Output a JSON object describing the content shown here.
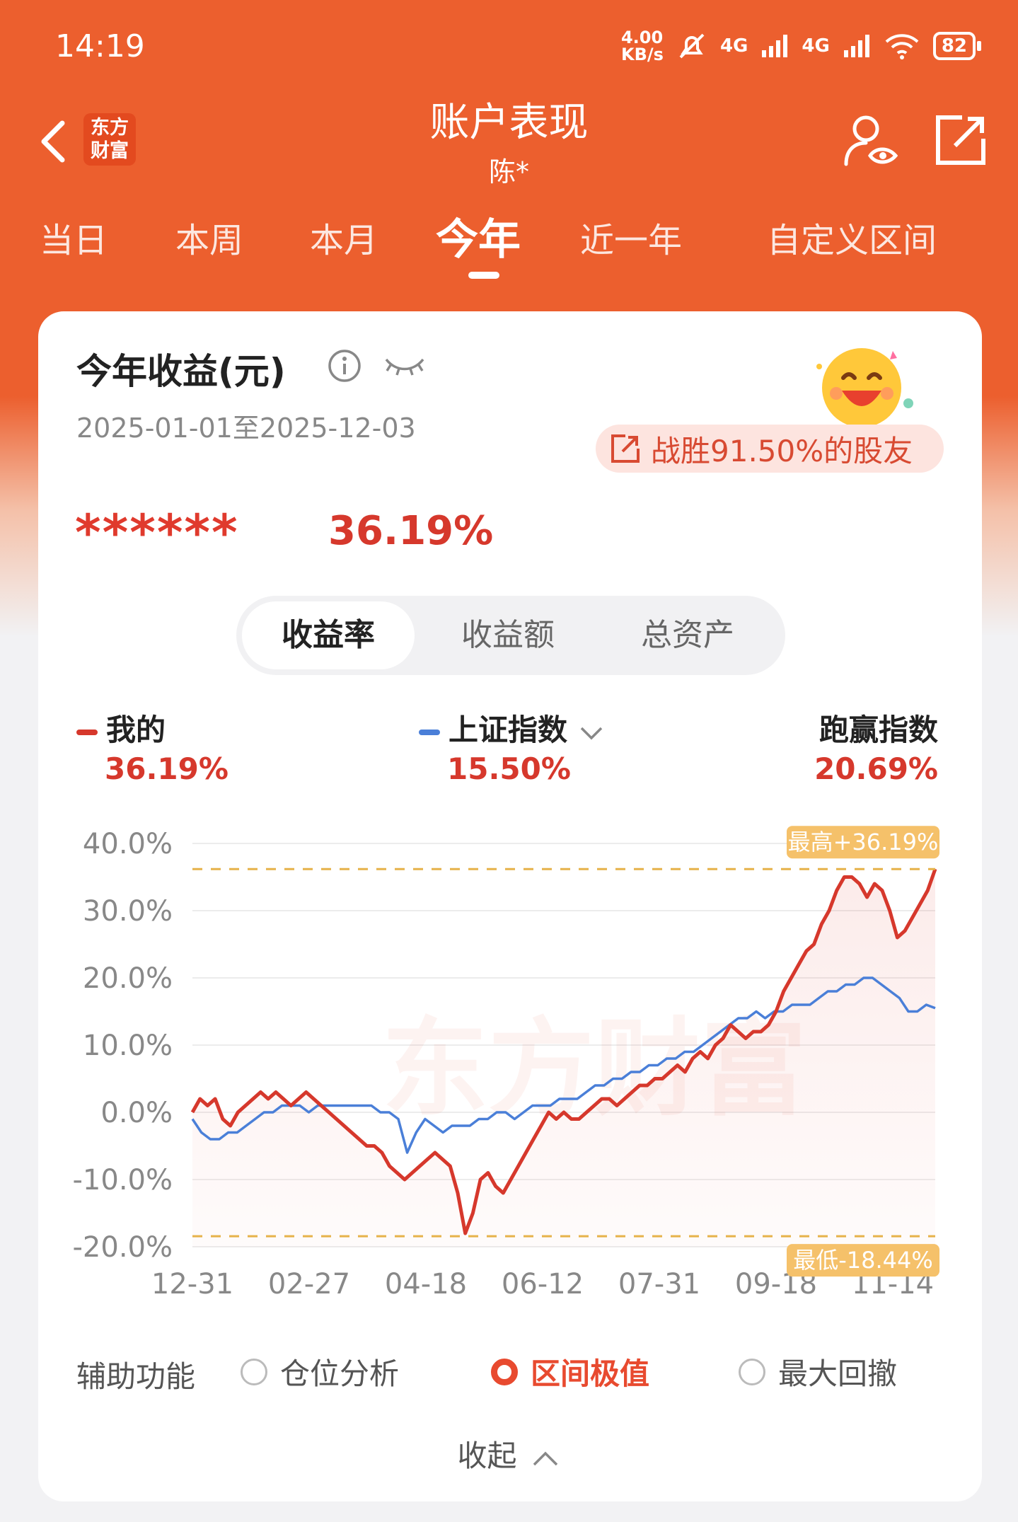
{
  "status_bar": {
    "time": "14:19",
    "net_speed_top": "4.00",
    "net_speed_unit": "KB/s",
    "signal1": "4G",
    "signal2": "4G",
    "battery": "82"
  },
  "header": {
    "logo_text": "东方财富",
    "title": "账户表现",
    "subtitle": "陈*"
  },
  "tabs": [
    {
      "label": "当日"
    },
    {
      "label": "本周"
    },
    {
      "label": "本月"
    },
    {
      "label": "今年"
    },
    {
      "label": "近一年"
    },
    {
      "label": "自定义区间"
    }
  ],
  "card": {
    "title": "今年收益(元)",
    "date_range": "2025-01-01至2025-12-03",
    "beat_text": "战胜91.50%的股友",
    "masked_amount": "******",
    "return_pct": "36.19%"
  },
  "segments": [
    {
      "label": "收益率"
    },
    {
      "label": "收益额"
    },
    {
      "label": "总资产"
    }
  ],
  "legend": {
    "mine_label": "我的",
    "mine_value": "36.19%",
    "index_label": "上证指数",
    "index_value": "15.50%",
    "beat_label": "跑赢指数",
    "beat_value": "20.69%"
  },
  "chart_data": {
    "type": "line",
    "y_ticks": [
      "40.0%",
      "30.0%",
      "20.0%",
      "10.0%",
      "0.0%",
      "-10.0%",
      "-20.0%"
    ],
    "ylim": [
      -20,
      40
    ],
    "x_ticks": [
      "12-31",
      "02-27",
      "04-18",
      "06-12",
      "07-31",
      "09-18",
      "11-14"
    ],
    "max_label": "最高+36.19%",
    "min_label": "最低-18.44%",
    "max_value": 36.19,
    "min_value": -18.44,
    "watermark": "东方财富",
    "series": [
      {
        "color": "#d6382c",
        "values": [
          0,
          2,
          1,
          2,
          -1,
          -2,
          0,
          1,
          2,
          3,
          2,
          3,
          2,
          1,
          2,
          3,
          2,
          1,
          0,
          -1,
          -2,
          -3,
          -4,
          -5,
          -5,
          -6,
          -8,
          -9,
          -10,
          -9,
          -8,
          -7,
          -6,
          -7,
          -8,
          -12,
          -18,
          -15,
          -10,
          -9,
          -11,
          -12,
          -10,
          -8,
          -6,
          -4,
          -2,
          0,
          -1,
          0,
          -1,
          -1,
          0,
          1,
          2,
          2,
          1,
          2,
          3,
          4,
          4,
          5,
          5,
          6,
          7,
          6,
          8,
          9,
          8,
          10,
          11,
          13,
          12,
          11,
          12,
          12,
          13,
          15,
          18,
          20,
          22,
          24,
          25,
          28,
          30,
          33,
          35,
          35,
          34,
          32,
          34,
          33,
          30,
          26,
          27,
          29,
          31,
          33,
          36.19
        ]
      },
      {
        "color": "#4a7fd8",
        "values": [
          -1,
          -3,
          -4,
          -4,
          -3,
          -3,
          -2,
          -1,
          0,
          0,
          1,
          1,
          1,
          0,
          1,
          1,
          1,
          1,
          1,
          1,
          1,
          0,
          0,
          -1,
          -6,
          -3,
          -1,
          -2,
          -3,
          -2,
          -2,
          -2,
          -1,
          -1,
          0,
          0,
          -1,
          0,
          1,
          1,
          1,
          2,
          2,
          2,
          3,
          4,
          4,
          5,
          5,
          6,
          6,
          7,
          7,
          8,
          8,
          9,
          9,
          10,
          11,
          12,
          13,
          14,
          14,
          15,
          14,
          15,
          15,
          16,
          16,
          16,
          17,
          18,
          18,
          19,
          19,
          20,
          20,
          19,
          18,
          17,
          15,
          15,
          16,
          15.5
        ]
      }
    ]
  },
  "helper": {
    "label": "辅助功能",
    "options": [
      {
        "label": "仓位分析"
      },
      {
        "label": "区间极值"
      },
      {
        "label": "最大回撤"
      }
    ]
  },
  "collapse_label": "收起"
}
